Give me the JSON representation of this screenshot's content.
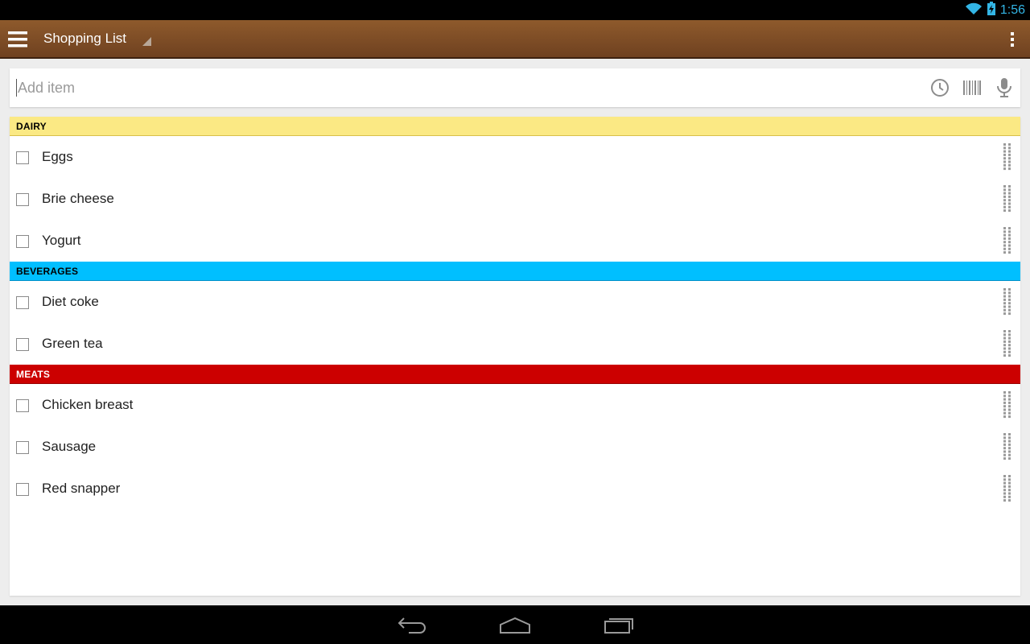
{
  "status": {
    "time": "1:56",
    "wifi_icon": "wifi-icon",
    "battery_icon": "battery-charging-icon"
  },
  "app_bar": {
    "title": "Shopping List",
    "menu_icon": "hamburger-menu-icon",
    "overflow_icon": "overflow-menu-icon"
  },
  "add_item": {
    "placeholder": "Add item",
    "value": "",
    "history_icon": "clock-icon",
    "barcode_icon": "barcode-icon",
    "voice_icon": "microphone-icon"
  },
  "categories": [
    {
      "name": "DAIRY",
      "color": "#fbe984",
      "text_color": "#000000",
      "border": "#d8c04a",
      "items": [
        {
          "label": "Eggs",
          "checked": false
        },
        {
          "label": "Brie cheese",
          "checked": false
        },
        {
          "label": "Yogurt",
          "checked": false
        }
      ]
    },
    {
      "name": "BEVERAGES",
      "color": "#00bfff",
      "text_color": "#000000",
      "border": "#0090c8",
      "items": [
        {
          "label": "Diet coke",
          "checked": false
        },
        {
          "label": "Green tea",
          "checked": false
        }
      ]
    },
    {
      "name": "MEATS",
      "color": "#cc0000",
      "text_color": "#ffffff",
      "border": "#990000",
      "items": [
        {
          "label": "Chicken breast",
          "checked": false
        },
        {
          "label": "Sausage",
          "checked": false
        },
        {
          "label": "Red snapper",
          "checked": false
        }
      ]
    }
  ],
  "nav": {
    "back_icon": "back-icon",
    "home_icon": "home-icon",
    "recents_icon": "recent-apps-icon"
  }
}
